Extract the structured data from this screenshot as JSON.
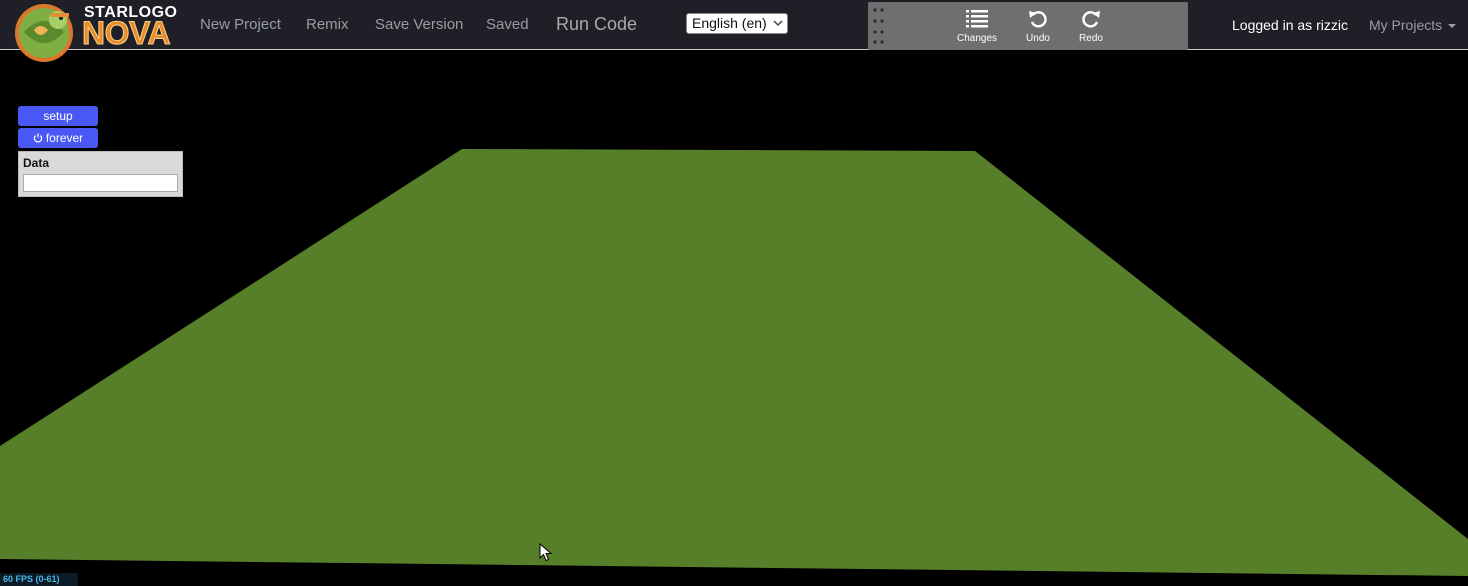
{
  "logo": {
    "line1": "STARLOGO",
    "line2": "NOVA"
  },
  "nav": {
    "new_project": "New Project",
    "remix": "Remix",
    "save_version": "Save Version",
    "saved": "Saved",
    "run_code": "Run Code"
  },
  "language": {
    "selected": "English (en)"
  },
  "history": {
    "changes_label": "Changes",
    "undo_label": "Undo",
    "redo_label": "Redo"
  },
  "user": {
    "logged_in_text": "Logged in as rizzic",
    "my_projects": "My Projects"
  },
  "widgets": {
    "setup_label": "setup",
    "forever_label": "forever",
    "data_title": "Data",
    "data_value": ""
  },
  "status": {
    "fps": "60 FPS (0-61)"
  },
  "colors": {
    "topbar_bg": "#1f2027",
    "terrain": "#577f2a",
    "button_blue": "#4a58f6",
    "logo_orange": "#e98b32"
  }
}
